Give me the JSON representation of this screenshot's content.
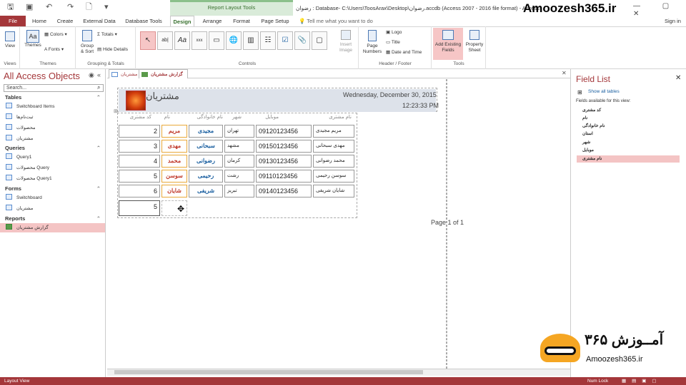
{
  "titlebar": {
    "context_title": "Report Layout Tools",
    "doc_title": "رضوان : Database- C:\\Users\\ToosArax\\Desktop\\رضوان.accdb (Access 2007 - 2016 file format) - Access",
    "watermark": "Amoozesh365.ir",
    "win_controls": "— ▢ ✕"
  },
  "tabs": [
    "File",
    "Home",
    "Create",
    "External Data",
    "Database Tools",
    "Design",
    "Arrange",
    "Format",
    "Page Setup"
  ],
  "active_tab": "Design",
  "tell_me": "Tell me what you want to do",
  "sign_in": "Sign in",
  "ribbon": {
    "groups": [
      "Views",
      "Themes",
      "Grouping & Totals",
      "Controls",
      "Header / Footer",
      "Tools"
    ],
    "buttons": {
      "view": "View",
      "themes": "Themes",
      "colors": "Colors",
      "fonts": "Fonts",
      "group_sort": "Group & Sort",
      "totals": "Totals",
      "hide_details": "Hide Details",
      "insert_image": "Insert Image",
      "page_numbers": "Page Numbers",
      "logo": "Logo",
      "title": "Title",
      "date_time": "Date and Time",
      "add_fields": "Add Existing Fields",
      "property_sheet": "Property Sheet"
    }
  },
  "nav": {
    "title": "All Access Objects",
    "search_placeholder": "Search...",
    "sections": [
      {
        "name": "Tables",
        "items": [
          "Switchboard Items",
          "ثبت‌نام‌ها",
          "محصولات",
          "مشتریان"
        ]
      },
      {
        "name": "Queries",
        "items": [
          "Query1",
          "محصولات Query",
          "محصولات Query1"
        ]
      },
      {
        "name": "Forms",
        "items": [
          "Switchboard",
          "مشتریان"
        ]
      },
      {
        "name": "Reports",
        "items": [
          "گزارش مشتریان"
        ]
      }
    ]
  },
  "doc_tabs": [
    "مشتریان",
    "گزارش مشتریان"
  ],
  "report": {
    "title": "مشتریان",
    "date": "Wednesday, December 30, 2015",
    "time": "12:23:33 PM",
    "columns": [
      "نام مشتری",
      "موبایل",
      "شهر",
      "نام خانوادگی",
      "نام",
      "کد مشتری"
    ],
    "rows": [
      {
        "full": "مریم مجیدی",
        "mobile": "09120123456",
        "city": "تهران",
        "last": "مجیدی",
        "first": "مریم",
        "id": "2"
      },
      {
        "full": "مهدی سبحانی",
        "mobile": "09150123456",
        "city": "مشهد",
        "last": "سبحانی",
        "first": "مهدی",
        "id": "3"
      },
      {
        "full": "محمد رضوانی",
        "mobile": "09130123456",
        "city": "کرمان",
        "last": "رضوانی",
        "first": "محمد",
        "id": "4"
      },
      {
        "full": "سوسن رحیمی",
        "mobile": "09110123456",
        "city": "رشت",
        "last": "رحیمی",
        "first": "سوسن",
        "id": "5"
      },
      {
        "full": "شایان شریفی",
        "mobile": "09140123456",
        "city": "تبریز",
        "last": "شریفی",
        "first": "شایان",
        "id": "6"
      }
    ],
    "count": "5",
    "page": "Page 1 of 1"
  },
  "field_list": {
    "title": "Field List",
    "show_all": "Show all tables",
    "available": "Fields available for this view:",
    "fields": [
      "کد مشتری",
      "نام",
      "نام خانوادگی",
      "استان",
      "شهر",
      "موبایل",
      "نام مشتری"
    ],
    "selected_field": "نام مشتری"
  },
  "status": {
    "left": "Layout View",
    "numlock": "Num Lock"
  },
  "brand": {
    "fa": "آمــوزش ۳۶۵",
    "url": "Amoozesh365.ir"
  },
  "colors": {
    "accent": "#a4373a",
    "context": "#38702e",
    "selected": "#f4c4c4"
  }
}
